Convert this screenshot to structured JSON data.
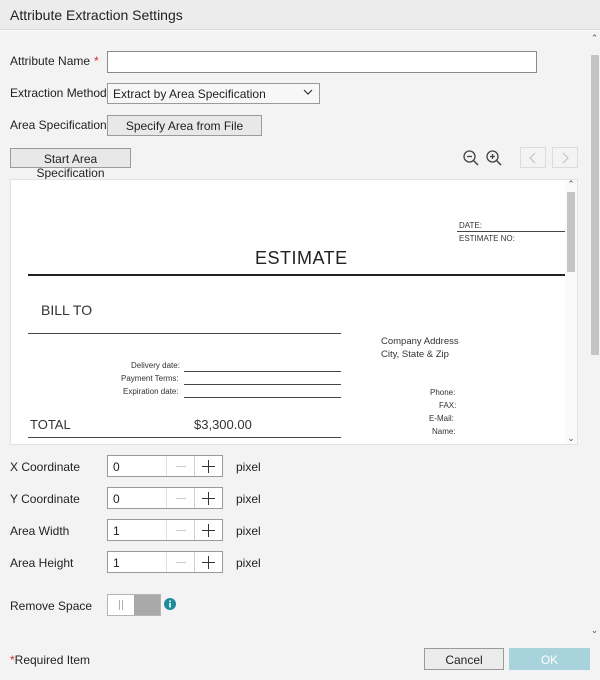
{
  "dialog": {
    "title": "Attribute Extraction Settings"
  },
  "form": {
    "attribute_name_label": "Attribute Name",
    "required_mark": "*",
    "attribute_name_value": "",
    "extraction_method_label": "Extraction Method",
    "extraction_method_value": "Extract by Area Specification",
    "area_specification_label": "Area Specification",
    "specify_area_button": "Specify Area from File",
    "start_area_button": "Start Area Specification"
  },
  "toolbar": {
    "zoom_out_icon": "zoom-out-icon",
    "zoom_in_icon": "zoom-in-icon",
    "prev_icon": "chevron-left-icon",
    "next_icon": "chevron-right-icon"
  },
  "document": {
    "date_label": "DATE:",
    "estimate_no_label": "ESTIMATE NO:",
    "title": "ESTIMATE",
    "bill_to": "BILL TO",
    "company_address": "Company Address",
    "city_state_zip": "City, State & Zip",
    "delivery_date": "Delivery date:",
    "payment_terms": "Payment Terms:",
    "expiration_date": "Expiration date:",
    "phone": "Phone:",
    "fax": "FAX:",
    "email": "E-Mail:",
    "name": "Name:",
    "total_label": "TOTAL",
    "total_value": "$3,300.00"
  },
  "coordinates": [
    {
      "label": "X Coordinate",
      "value": "0",
      "unit": "pixel"
    },
    {
      "label": "Y Coordinate",
      "value": "0",
      "unit": "pixel"
    },
    {
      "label": "Area Width",
      "value": "1",
      "unit": "pixel"
    },
    {
      "label": "Area Height",
      "value": "1",
      "unit": "pixel"
    }
  ],
  "remove_space": {
    "label": "Remove Space",
    "enabled": false
  },
  "footer": {
    "required_star": "*",
    "required_note": "Required Item",
    "cancel_label": "Cancel",
    "ok_label": "OK"
  },
  "colors": {
    "ok_button": "#a8d3dc",
    "info_icon": "#1f8a99",
    "required": "#d62a2a"
  }
}
